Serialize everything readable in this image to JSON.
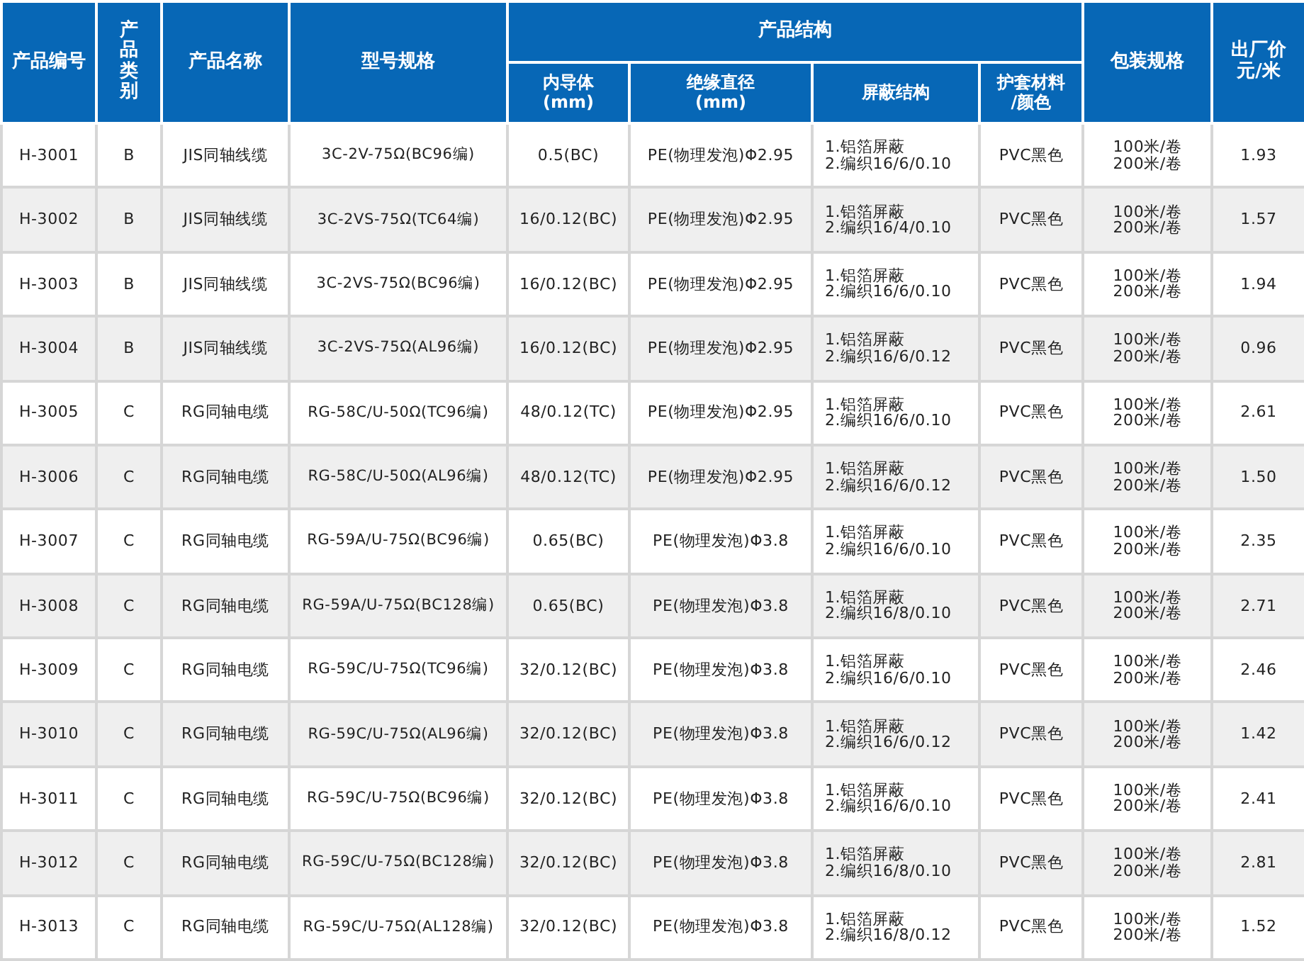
{
  "table": {
    "header_rows": [
      [
        {
          "lines": [
            "产品编号"
          ],
          "rowspan": 2
        },
        {
          "lines": [
            "产品类别"
          ],
          "rowspan": 2,
          "vertical": true
        },
        {
          "lines": [
            "产品名称"
          ],
          "rowspan": 2
        },
        {
          "lines": [
            "型号规格"
          ],
          "rowspan": 2
        },
        {
          "lines": [
            "产品结构"
          ],
          "colspan": 4
        },
        {
          "lines": [
            "包装规格"
          ],
          "rowspan": 2
        },
        {
          "lines": [
            "出厂价",
            "元/米"
          ],
          "rowspan": 2
        }
      ],
      [
        {
          "lines": [
            "内导体",
            "(mm)"
          ]
        },
        {
          "lines": [
            "绝缘直径",
            "(mm)"
          ]
        },
        {
          "lines": [
            "屏蔽结构"
          ]
        },
        {
          "lines": [
            "护套材料",
            "/颜色"
          ]
        }
      ]
    ],
    "rows": [
      [
        "H-3001",
        "B",
        "JIS同轴线缆",
        "3C-2V-75Ω(BC96编)",
        "0.5(BC)",
        "PE(物理发泡)Φ2.95",
        "1.铝箔屏蔽\n2.编织16/6/0.10",
        "PVC黑色",
        "100米/卷\n200米/卷",
        "1.93"
      ],
      [
        "H-3002",
        "B",
        "JIS同轴线缆",
        "3C-2VS-75Ω(TC64编)",
        "16/0.12(BC)",
        "PE(物理发泡)Φ2.95",
        "1.铝箔屏蔽\n2.编织16/4/0.10",
        "PVC黑色",
        "100米/卷\n200米/卷",
        "1.57"
      ],
      [
        "H-3003",
        "B",
        "JIS同轴线缆",
        "3C-2VS-75Ω(BC96编)",
        "16/0.12(BC)",
        "PE(物理发泡)Φ2.95",
        "1.铝箔屏蔽\n2.编织16/6/0.10",
        "PVC黑色",
        "100米/卷\n200米/卷",
        "1.94"
      ],
      [
        "H-3004",
        "B",
        "JIS同轴线缆",
        "3C-2VS-75Ω(AL96编)",
        "16/0.12(BC)",
        "PE(物理发泡)Φ2.95",
        "1.铝箔屏蔽\n2.编织16/6/0.12",
        "PVC黑色",
        "100米/卷\n200米/卷",
        "0.96"
      ],
      [
        "H-3005",
        "C",
        "RG同轴电缆",
        "RG-58C/U-50Ω(TC96编)",
        "48/0.12(TC)",
        "PE(物理发泡)Φ2.95",
        "1.铝箔屏蔽\n2.编织16/6/0.10",
        "PVC黑色",
        "100米/卷\n200米/卷",
        "2.61"
      ],
      [
        "H-3006",
        "C",
        "RG同轴电缆",
        "RG-58C/U-50Ω(AL96编)",
        "48/0.12(TC)",
        "PE(物理发泡)Φ2.95",
        "1.铝箔屏蔽\n2.编织16/6/0.12",
        "PVC黑色",
        "100米/卷\n200米/卷",
        "1.50"
      ],
      [
        "H-3007",
        "C",
        "RG同轴电缆",
        "RG-59A/U-75Ω(BC96编)",
        "0.65(BC)",
        "PE(物理发泡)Φ3.8",
        "1.铝箔屏蔽\n2.编织16/6/0.10",
        "PVC黑色",
        "100米/卷\n200米/卷",
        "2.35"
      ],
      [
        "H-3008",
        "C",
        "RG同轴电缆",
        "RG-59A/U-75Ω(BC128编)",
        "0.65(BC)",
        "PE(物理发泡)Φ3.8",
        "1.铝箔屏蔽\n2.编织16/8/0.10",
        "PVC黑色",
        "100米/卷\n200米/卷",
        "2.71"
      ],
      [
        "H-3009",
        "C",
        "RG同轴电缆",
        "RG-59C/U-75Ω(TC96编)",
        "32/0.12(BC)",
        "PE(物理发泡)Φ3.8",
        "1.铝箔屏蔽\n2.编织16/6/0.10",
        "PVC黑色",
        "100米/卷\n200米/卷",
        "2.46"
      ],
      [
        "H-3010",
        "C",
        "RG同轴电缆",
        "RG-59C/U-75Ω(AL96编)",
        "32/0.12(BC)",
        "PE(物理发泡)Φ3.8",
        "1.铝箔屏蔽\n2.编织16/6/0.12",
        "PVC黑色",
        "100米/卷\n200米/卷",
        "1.42"
      ],
      [
        "H-3011",
        "C",
        "RG同轴电缆",
        "RG-59C/U-75Ω(BC96编)",
        "32/0.12(BC)",
        "PE(物理发泡)Φ3.8",
        "1.铝箔屏蔽\n2.编织16/6/0.10",
        "PVC黑色",
        "100米/卷\n200米/卷",
        "2.41"
      ],
      [
        "H-3012",
        "C",
        "RG同轴电缆",
        "RG-59C/U-75Ω(BC128编)",
        "32/0.12(BC)",
        "PE(物理发泡)Φ3.8",
        "1.铝箔屏蔽\n2.编织16/8/0.10",
        "PVC黑色",
        "100米/卷\n200米/卷",
        "2.81"
      ],
      [
        "H-3013",
        "C",
        "RG同轴电缆",
        "RG-59C/U-75Ω(AL128编)",
        "32/0.12(BC)",
        "PE(物理发泡)Φ3.8",
        "1.铝箔屏蔽\n2.编织16/8/0.12",
        "PVC黑色",
        "100米/卷\n200米/卷",
        "1.52"
      ]
    ]
  }
}
